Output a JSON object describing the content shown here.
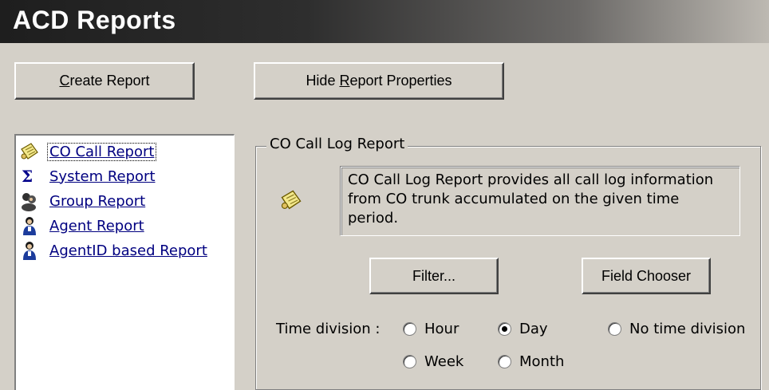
{
  "window": {
    "title": "ACD Reports"
  },
  "toolbar": {
    "create_report": {
      "prefix": "",
      "mnemonic": "C",
      "suffix": "reate Report"
    },
    "hide_properties": {
      "prefix": "Hide ",
      "mnemonic": "R",
      "suffix": "eport Properties"
    }
  },
  "report_list": {
    "selected_index": 0,
    "items": [
      {
        "label": "CO Call Report",
        "icon": "notepad-icon"
      },
      {
        "label": "System Report",
        "icon": "sigma-icon"
      },
      {
        "label": "Group Report",
        "icon": "group-people-icon"
      },
      {
        "label": "Agent Report",
        "icon": "agent-person-icon"
      },
      {
        "label": "AgentID based Report",
        "icon": "agent-person-icon"
      }
    ]
  },
  "properties": {
    "group_title": "CO Call Log Report",
    "description": "CO Call Log Report provides all call log information from CO trunk accumulated on the given time period.",
    "icon": "notepad-icon",
    "filter_button": "Filter...",
    "field_chooser_button": "Field Chooser",
    "time_division_label": "Time division :",
    "time_division_options": [
      {
        "label": "Hour",
        "selected": false
      },
      {
        "label": "Day",
        "selected": true
      },
      {
        "label": "No time division",
        "selected": false
      },
      {
        "label": "Week",
        "selected": false
      },
      {
        "label": "Month",
        "selected": false
      }
    ]
  },
  "colors": {
    "window_bg": "#d4d0c8",
    "title_text": "#ffffff",
    "link_text": "#000080"
  }
}
